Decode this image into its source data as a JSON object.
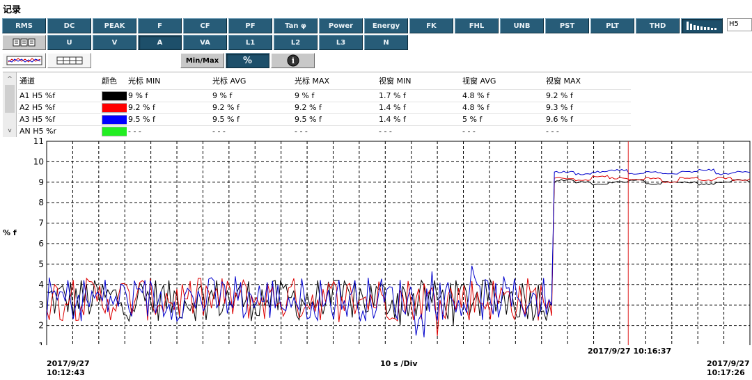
{
  "window": {
    "title": "记录"
  },
  "toolbar": {
    "row1": [
      "RMS",
      "DC",
      "PEAK",
      "F",
      "CF",
      "PF",
      "Tan φ",
      "Power",
      "Energy",
      "FK",
      "FHL",
      "UNB",
      "PST",
      "PLT",
      "THD"
    ],
    "row2": [
      "U",
      "V",
      "A",
      "VA",
      "L1",
      "L2",
      "L3",
      "N"
    ],
    "row3_minmax": "Min/Max",
    "row3_percent": "%",
    "info_icon": "i",
    "harmonic_select": "H5"
  },
  "table": {
    "headers": [
      "通道",
      "颜色",
      "光标 MIN",
      "光标 AVG",
      "光标 MAX",
      "视窗 MIN",
      "视窗 AVG",
      "视窗 MAX"
    ],
    "rows": [
      {
        "channel": "A1 H5 %f",
        "color": "#000000",
        "cursor_min": "9 % f",
        "cursor_avg": "9 % f",
        "cursor_max": "9 % f",
        "win_min": "1.7 % f",
        "win_avg": "4.8 % f",
        "win_max": "9.2 % f"
      },
      {
        "channel": "A2 H5 %f",
        "color": "#ff0000",
        "cursor_min": "9.2 % f",
        "cursor_avg": "9.2 % f",
        "cursor_max": "9.2 % f",
        "win_min": "1.4 % f",
        "win_avg": "4.8 % f",
        "win_max": "9.3 % f"
      },
      {
        "channel": "A3 H5 %f",
        "color": "#0000ff",
        "cursor_min": "9.5 % f",
        "cursor_avg": "9.5 % f",
        "cursor_max": "9.5 % f",
        "win_min": "1.4 % f",
        "win_avg": "5 % f",
        "win_max": "9.6 % f"
      },
      {
        "channel": "AN H5 %r",
        "color": "#22ee22",
        "cursor_min": "- - -",
        "cursor_avg": "- - -",
        "cursor_max": "- - -",
        "win_min": "- - -",
        "win_avg": "- - -",
        "win_max": "- - -"
      }
    ]
  },
  "chart_data": {
    "type": "line",
    "ylabel": "% f",
    "ylim": [
      1,
      11
    ],
    "yticks": [
      1,
      2,
      3,
      4,
      5,
      6,
      7,
      8,
      9,
      10,
      11
    ],
    "x_start": {
      "date": "2017/9/27",
      "time": "10:12:43"
    },
    "x_end": {
      "date": "2017/9/27",
      "time": "10:17:26"
    },
    "xdiv_label": "10 s /Div",
    "cursor": {
      "label": "2017/9/27 10:16:37",
      "fraction": 0.827
    },
    "grid": true,
    "step_fraction": 0.722,
    "series": [
      {
        "channel": "A1",
        "color": "#000000",
        "before_range": [
          2.0,
          4.2
        ],
        "after_level": 9.0,
        "after_values": [
          9.1,
          9.0,
          8.9,
          9.0,
          9.1,
          8.9,
          9.0,
          9.0,
          8.9,
          9.0,
          9.1,
          9.0
        ]
      },
      {
        "channel": "A2",
        "color": "#dd0000",
        "before_range": [
          1.4,
          4.3
        ],
        "after_level": 9.2,
        "after_values": [
          9.2,
          9.1,
          9.3,
          9.2,
          9.1,
          9.2,
          9.0,
          9.2,
          9.1,
          9.2,
          9.1,
          9.2
        ]
      },
      {
        "channel": "A3",
        "color": "#0000cc",
        "before_range": [
          1.4,
          5.0
        ],
        "after_level": 9.5,
        "after_values": [
          9.5,
          9.4,
          9.5,
          9.6,
          9.4,
          9.5,
          9.4,
          9.5,
          9.6,
          9.4,
          9.5,
          9.5
        ]
      }
    ]
  }
}
